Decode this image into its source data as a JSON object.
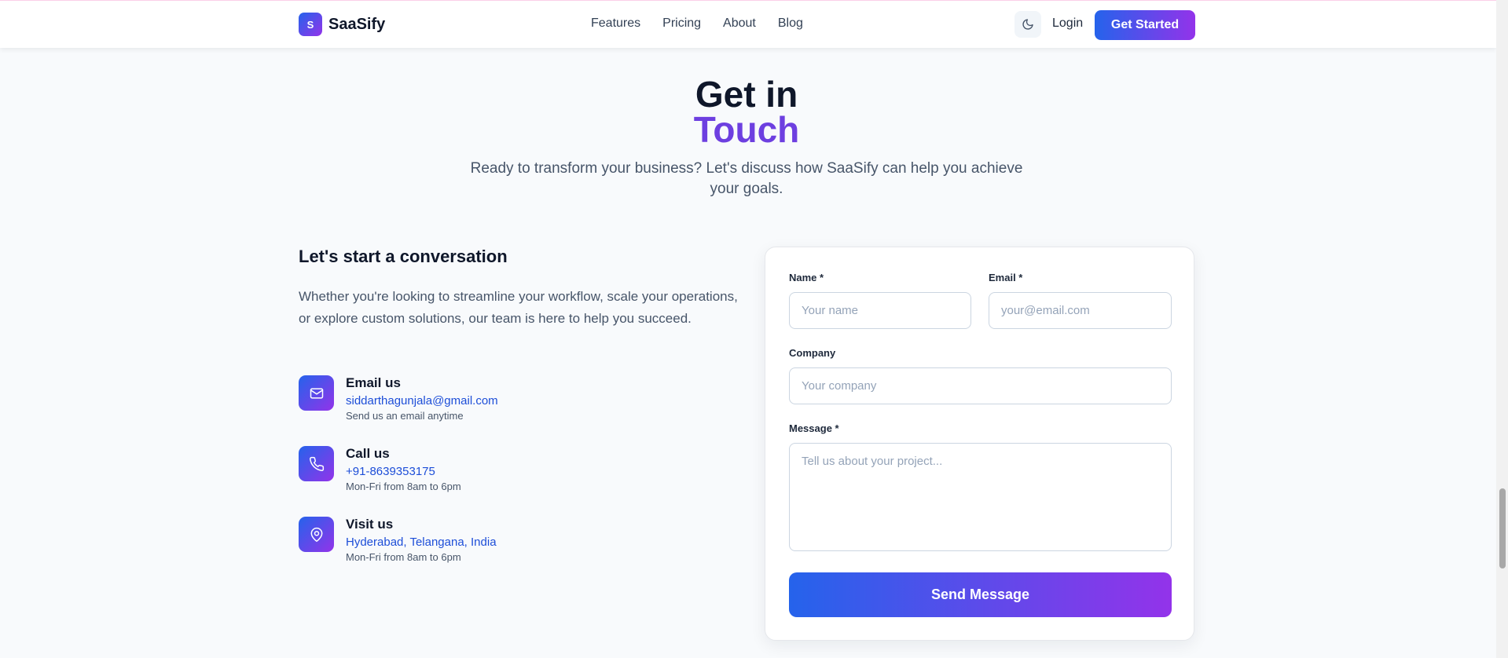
{
  "nav": {
    "logo_letter": "S",
    "brand": "SaaSify",
    "links": [
      "Features",
      "Pricing",
      "About",
      "Blog"
    ],
    "login": "Login",
    "cta": "Get Started",
    "theme_icon": "moon-icon"
  },
  "hero": {
    "title_line1": "Get in",
    "title_line2": "Touch",
    "subtitle": "Ready to transform your business? Let's discuss how SaaSify can help you achieve your goals."
  },
  "intro": {
    "heading": "Let's start a conversation",
    "body": "Whether you're looking to streamline your workflow, scale your operations, or explore custom solutions, our team is here to help you succeed."
  },
  "contacts": [
    {
      "icon": "mail-icon",
      "title": "Email us",
      "link": "siddarthagunjala@gmail.com",
      "note": "Send us an email anytime"
    },
    {
      "icon": "phone-icon",
      "title": "Call us",
      "link": "+91-8639353175",
      "note": "Mon-Fri from 8am to 6pm"
    },
    {
      "icon": "map-pin-icon",
      "title": "Visit us",
      "link": "Hyderabad, Telangana, India",
      "note": "Mon-Fri from 8am to 6pm"
    }
  ],
  "form": {
    "name_label": "Name *",
    "name_placeholder": "Your name",
    "email_label": "Email *",
    "email_placeholder": "your@email.com",
    "company_label": "Company",
    "company_placeholder": "Your company",
    "message_label": "Message *",
    "message_placeholder": "Tell us about your project...",
    "submit": "Send Message"
  },
  "colors": {
    "accent_start": "#2563eb",
    "accent_end": "#9333ea",
    "title_accent": "#6d3fe0",
    "link": "#1d4ed8"
  }
}
